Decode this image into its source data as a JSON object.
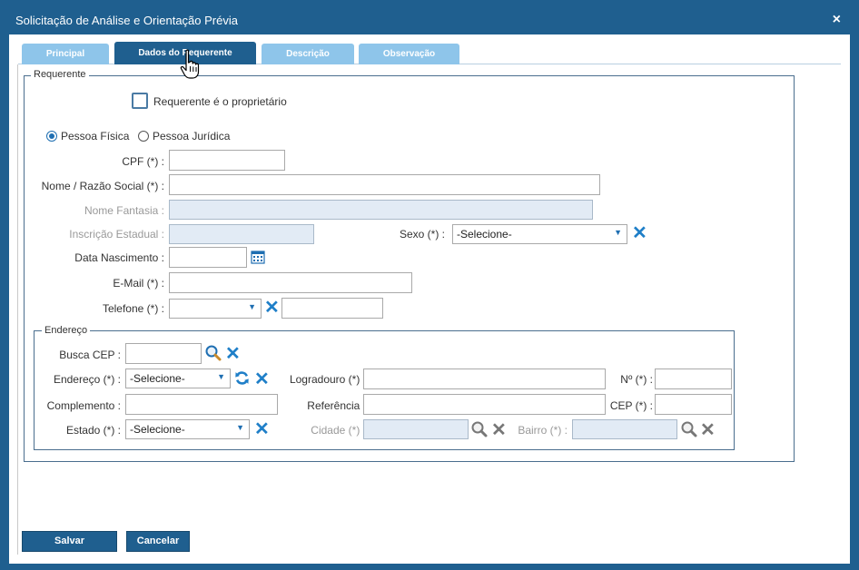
{
  "window": {
    "title": "Solicitação de Análise e Orientação Prévia",
    "close_label": "×"
  },
  "tabs": [
    {
      "label": "Principal"
    },
    {
      "label": "Dados do Requerente"
    },
    {
      "label": "Descrição"
    },
    {
      "label": "Observação"
    }
  ],
  "requerente": {
    "legend": "Requerente",
    "owner_checkbox_label": "Requerente é o proprietário",
    "radio_fisica": "Pessoa Física",
    "radio_juridica": "Pessoa Jurídica",
    "cpf_label": "CPF (*) :",
    "nome_label": "Nome / Razão Social (*) :",
    "fantasia_label": "Nome Fantasia :",
    "inscricao_label": "Inscrição Estadual :",
    "sexo_label": "Sexo (*) :",
    "sexo_value": "-Selecione-",
    "nascimento_label": "Data Nascimento :",
    "email_label": "E-Mail (*) :",
    "telefone_label": "Telefone (*) :",
    "telefone_tipo_value": ""
  },
  "endereco": {
    "legend": "Endereço",
    "busca_cep_label": "Busca CEP :",
    "endereco_label": "Endereço (*) :",
    "endereco_value": "-Selecione-",
    "logradouro_label": "Logradouro (*) :",
    "numero_label": "Nº (*) :",
    "complemento_label": "Complemento :",
    "referencia_label": "Referência :",
    "cep_label": "CEP (*) :",
    "estado_label": "Estado (*) :",
    "estado_value": "-Selecione-",
    "cidade_label": "Cidade (*) :",
    "bairro_label": "Bairro (*) :"
  },
  "footer": {
    "save_label": "Salvar",
    "cancel_label": "Cancelar"
  },
  "colors": {
    "header": "#1f5f8f",
    "tab_inactive": "#8ec5ea",
    "accent": "#1f7fc8"
  }
}
